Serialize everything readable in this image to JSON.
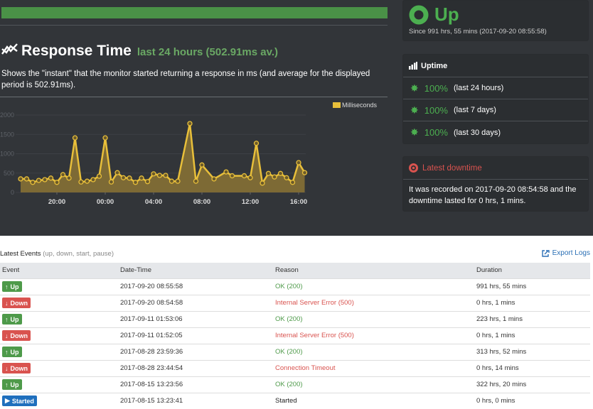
{
  "response_time": {
    "title": "Response Time",
    "subtitle": "last 24 hours (502.91ms av.)",
    "description": "Shows the \"instant\" that the monitor started returning a response in ms (and average for the displayed period is 502.91ms).",
    "icon": "line-chart-icon"
  },
  "status": {
    "label": "Up",
    "since": "Since 991 hrs, 55 mins (2017-09-20 08:55:58)",
    "color": "#4caf50"
  },
  "uptime": {
    "title": "Uptime",
    "rows": [
      {
        "pct": "100%",
        "label": "(last 24 hours)"
      },
      {
        "pct": "100%",
        "label": "(last 7 days)"
      },
      {
        "pct": "100%",
        "label": "(last 30 days)"
      }
    ]
  },
  "downtime": {
    "title": "Latest downtime",
    "text": "It was recorded on 2017-09-20 08:54:58 and the downtime lasted for 0 hrs, 1 mins."
  },
  "events": {
    "title": "Latest Events",
    "filter": "(up, down, start, pause)",
    "export_label": "Export Logs",
    "columns": [
      "Event",
      "Date-Time",
      "Reason",
      "Duration"
    ],
    "rows": [
      {
        "type": "up",
        "event": "Up",
        "datetime": "2017-09-20 08:55:58",
        "reason": "OK (200)",
        "duration": "991 hrs, 55 mins"
      },
      {
        "type": "down",
        "event": "Down",
        "datetime": "2017-09-20 08:54:58",
        "reason": "Internal Server Error (500)",
        "duration": "0 hrs, 1 mins"
      },
      {
        "type": "up",
        "event": "Up",
        "datetime": "2017-09-11 01:53:06",
        "reason": "OK (200)",
        "duration": "223 hrs, 1 mins"
      },
      {
        "type": "down",
        "event": "Down",
        "datetime": "2017-09-11 01:52:05",
        "reason": "Internal Server Error (500)",
        "duration": "0 hrs, 1 mins"
      },
      {
        "type": "up",
        "event": "Up",
        "datetime": "2017-08-28 23:59:36",
        "reason": "OK (200)",
        "duration": "313 hrs, 52 mins"
      },
      {
        "type": "down",
        "event": "Down",
        "datetime": "2017-08-28 23:44:54",
        "reason": "Connection Timeout",
        "duration": "0 hrs, 14 mins"
      },
      {
        "type": "up",
        "event": "Up",
        "datetime": "2017-08-15 13:23:56",
        "reason": "OK (200)",
        "duration": "322 hrs, 20 mins"
      },
      {
        "type": "started",
        "event": "Started",
        "datetime": "2017-08-15 13:23:41",
        "reason": "Started",
        "duration": "0 hrs, 0 mins"
      }
    ]
  },
  "chart_data": {
    "type": "area",
    "title": "",
    "xlabel": "",
    "ylabel": "",
    "legend": {
      "label": "Milliseconds",
      "position": "top-right",
      "color": "#e8bf3a"
    },
    "ylim": [
      0,
      2000
    ],
    "yticks": [
      0,
      500,
      1000,
      1500,
      2000
    ],
    "xticks": [
      "20:00",
      "00:00",
      "04:00",
      "08:00",
      "12:00",
      "16:00"
    ],
    "x_hours": [
      17.0,
      17.5,
      18.0,
      18.5,
      19.0,
      19.5,
      20.0,
      20.5,
      21.0,
      21.5,
      22.0,
      22.5,
      23.0,
      23.5,
      24.0,
      24.5,
      25.0,
      25.5,
      26.0,
      26.5,
      27.0,
      27.5,
      28.0,
      28.5,
      29.0,
      29.5,
      30.0,
      31.0,
      31.5,
      32.0,
      33.0,
      34.0,
      34.5,
      35.5,
      36.0,
      36.5,
      37.0,
      37.5,
      38.0,
      38.5,
      39.0,
      39.5,
      40.0,
      40.5
    ],
    "series": [
      {
        "name": "Milliseconds",
        "values": [
          350,
          350,
          260,
          310,
          330,
          370,
          260,
          460,
          370,
          1410,
          270,
          290,
          330,
          420,
          1410,
          270,
          510,
          380,
          370,
          260,
          370,
          280,
          480,
          440,
          440,
          290,
          290,
          1780,
          290,
          710,
          350,
          530,
          430,
          430,
          380,
          1270,
          240,
          490,
          400,
          490,
          380,
          260,
          770,
          510
        ]
      }
    ]
  }
}
